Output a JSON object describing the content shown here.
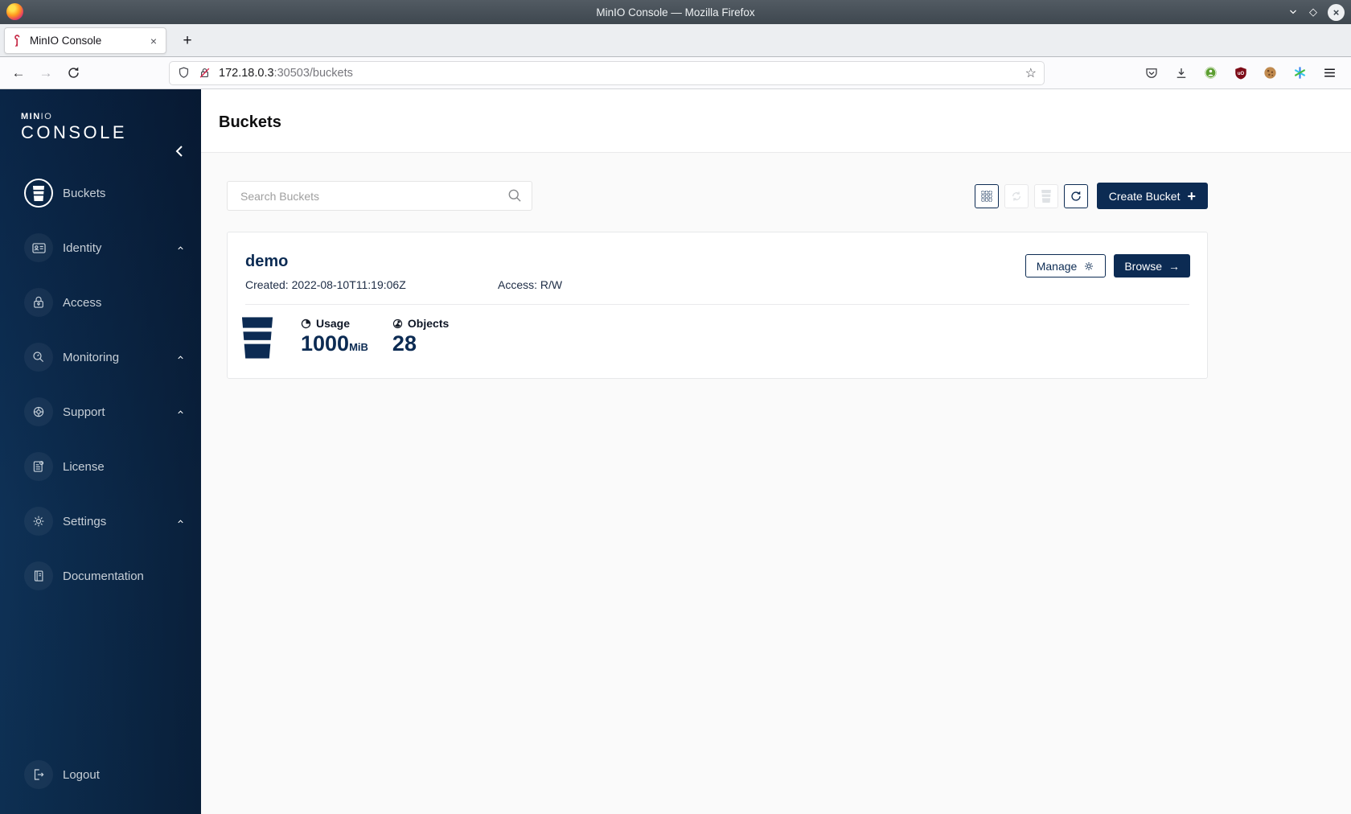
{
  "window_title": "MinIO Console — Mozilla Firefox",
  "browser": {
    "tab_title": "MinIO Console",
    "url_host": "172.18.0.3",
    "url_rest": ":30503/buckets"
  },
  "glyphs": {
    "back": "←",
    "forward": "→",
    "star": "☆",
    "new_tab": "+",
    "close_tab": "×",
    "window_maximize": "◇",
    "window_close": "×",
    "browse_arrow": "→",
    "create_plus": "+"
  },
  "sidebar": {
    "logo_bold": "MIN",
    "logo_light": "IO",
    "logo_word": "CONSOLE",
    "items": [
      {
        "label": "Buckets"
      },
      {
        "label": "Identity"
      },
      {
        "label": "Access"
      },
      {
        "label": "Monitoring"
      },
      {
        "label": "Support"
      },
      {
        "label": "License"
      },
      {
        "label": "Settings"
      },
      {
        "label": "Documentation"
      }
    ],
    "logout_label": "Logout"
  },
  "page": {
    "title": "Buckets",
    "search_placeholder": "Search Buckets",
    "create_bucket_label": "Create Bucket"
  },
  "bucket_card": {
    "name": "demo",
    "created": "Created: 2022-08-10T11:19:06Z",
    "access": "Access: R/W",
    "manage_label": "Manage",
    "browse_label": "Browse",
    "usage_label": "Usage",
    "usage_value": "1000",
    "usage_unit": "MiB",
    "objects_label": "Objects",
    "objects_value": "28"
  },
  "colors": {
    "navy": "#0c2b53",
    "minio_red": "#c72c48",
    "page_bg": "#fafafa"
  }
}
